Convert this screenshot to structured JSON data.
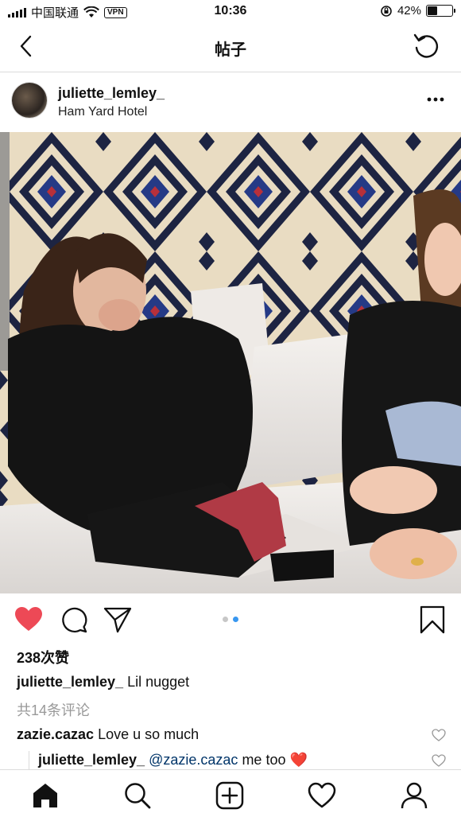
{
  "status_bar": {
    "carrier": "中国联通",
    "vpn": "VPN",
    "time": "10:36",
    "battery": "42%",
    "battery_level": 0.42
  },
  "nav": {
    "title": "帖子"
  },
  "post": {
    "username": "juliette_lemley_",
    "location": "Ham Yard Hotel",
    "likes": "238次赞",
    "caption_user": "juliette_lemley_",
    "caption_text": "Lil nugget",
    "view_comments": "共14条评论",
    "carousel_count": 2,
    "carousel_active": 2
  },
  "comments": [
    {
      "user": "zazie.cazac",
      "text": "Love u so much"
    },
    {
      "user": "juliette_lemley_",
      "mention": "@zazie.cazac",
      "text": "me too ❤️"
    }
  ],
  "colors": {
    "like_red": "#ed4956",
    "link_blue": "#003569",
    "dot_blue": "#3897f0"
  },
  "icons": [
    "back-icon",
    "refresh-icon",
    "more-icon",
    "heart-icon",
    "comment-icon",
    "share-icon",
    "bookmark-icon",
    "home-icon",
    "search-icon",
    "add-icon",
    "activity-icon",
    "profile-icon"
  ]
}
